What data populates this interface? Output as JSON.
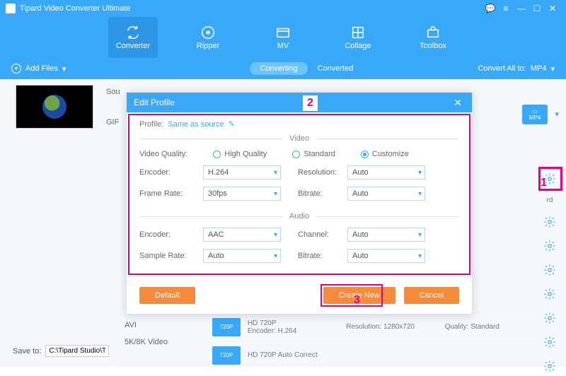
{
  "app": {
    "title": "Tipard Video Converter Ultimate"
  },
  "toolbar": {
    "items": [
      {
        "label": "Converter"
      },
      {
        "label": "Ripper"
      },
      {
        "label": "MV"
      },
      {
        "label": "Collage"
      },
      {
        "label": "Toolbox"
      }
    ]
  },
  "subbar": {
    "add_files": "Add Files",
    "tab_converting": "Converting",
    "tab_converted": "Converted",
    "convert_all_label": "Convert All to:",
    "convert_all_value": "MP4"
  },
  "item": {
    "sou": "Sou",
    "gif": "GIF",
    "mp4_badge": "MP4"
  },
  "side_categories": [
    "AVI",
    "5K/8K Video"
  ],
  "gear_rd": "rd",
  "presets": [
    {
      "badge": "720P",
      "title": "HD 720P",
      "sub": "Encoder: H.264",
      "res": "Resolution: 1280x720",
      "qual": "Quality: Standard"
    },
    {
      "badge": "720P",
      "title": "HD 720P Auto Correct",
      "sub": "",
      "res": "",
      "qual": ""
    }
  ],
  "saveto": {
    "label": "Save to:",
    "path": "C:\\Tipard Studio\\T"
  },
  "modal": {
    "title": "Edit Profile",
    "profile_label": "Profile:",
    "profile_value": "Same as source",
    "video_legend": "Video",
    "audio_legend": "Audio",
    "video_quality_label": "Video Quality:",
    "vq_high": "High Quality",
    "vq_standard": "Standard",
    "vq_customize": "Customize",
    "encoder_label": "Encoder:",
    "resolution_label": "Resolution:",
    "framerate_label": "Frame Rate:",
    "bitrate_label": "Bitrate:",
    "samplerate_label": "Sample Rate:",
    "channel_label": "Channel:",
    "video": {
      "encoder": "H.264",
      "resolution": "Auto",
      "framerate": "30fps",
      "bitrate": "Auto"
    },
    "audio": {
      "encoder": "AAC",
      "channel": "Auto",
      "samplerate": "Auto",
      "bitrate": "Auto"
    },
    "btn_default": "Default",
    "btn_create": "Create New",
    "btn_cancel": "Cancel"
  },
  "annotations": {
    "n1": "1",
    "n2": "2",
    "n3": "3"
  }
}
